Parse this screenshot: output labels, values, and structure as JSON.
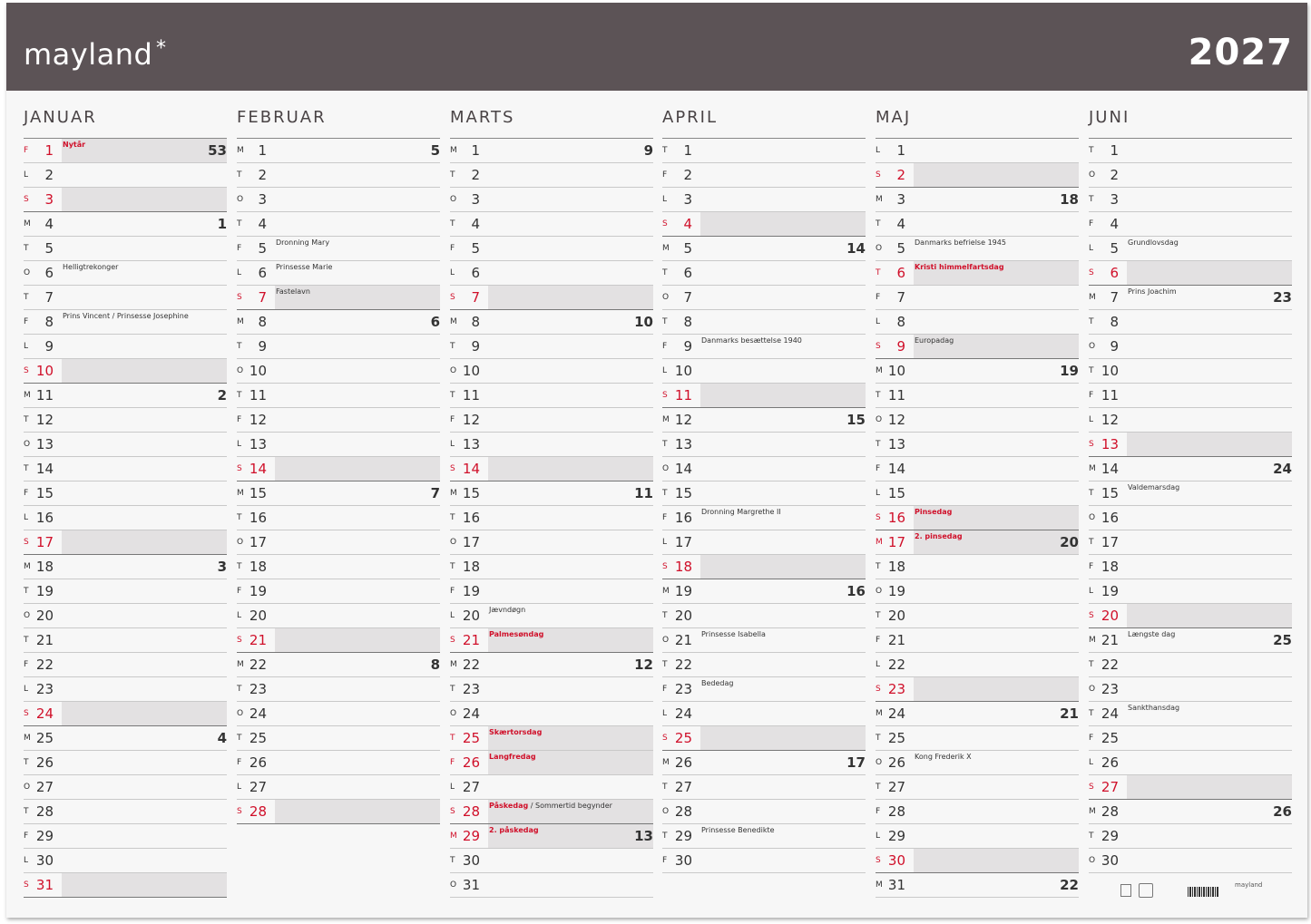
{
  "header": {
    "brand": "mayland",
    "year": "2027"
  },
  "months": [
    {
      "name": "JANUAR",
      "days": [
        {
          "d": "1",
          "w": "F",
          "red": true,
          "note": "Nytår",
          "red_note": true,
          "week": "53",
          "shade": true
        },
        {
          "d": "2",
          "w": "L"
        },
        {
          "d": "3",
          "w": "S",
          "red": true,
          "sun": true
        },
        {
          "d": "4",
          "w": "M",
          "week": "1"
        },
        {
          "d": "5",
          "w": "T"
        },
        {
          "d": "6",
          "w": "O",
          "note": "Helligtrekonger"
        },
        {
          "d": "7",
          "w": "T"
        },
        {
          "d": "8",
          "w": "F",
          "note": "Prins Vincent / Prinsesse Josephine"
        },
        {
          "d": "9",
          "w": "L"
        },
        {
          "d": "10",
          "w": "S",
          "red": true,
          "sun": true
        },
        {
          "d": "11",
          "w": "M",
          "week": "2"
        },
        {
          "d": "12",
          "w": "T"
        },
        {
          "d": "13",
          "w": "O"
        },
        {
          "d": "14",
          "w": "T"
        },
        {
          "d": "15",
          "w": "F"
        },
        {
          "d": "16",
          "w": "L"
        },
        {
          "d": "17",
          "w": "S",
          "red": true,
          "sun": true
        },
        {
          "d": "18",
          "w": "M",
          "week": "3"
        },
        {
          "d": "19",
          "w": "T"
        },
        {
          "d": "20",
          "w": "O"
        },
        {
          "d": "21",
          "w": "T"
        },
        {
          "d": "22",
          "w": "F"
        },
        {
          "d": "23",
          "w": "L"
        },
        {
          "d": "24",
          "w": "S",
          "red": true,
          "sun": true
        },
        {
          "d": "25",
          "w": "M",
          "week": "4"
        },
        {
          "d": "26",
          "w": "T"
        },
        {
          "d": "27",
          "w": "O"
        },
        {
          "d": "28",
          "w": "T"
        },
        {
          "d": "29",
          "w": "F"
        },
        {
          "d": "30",
          "w": "L"
        },
        {
          "d": "31",
          "w": "S",
          "red": true,
          "sun": true
        }
      ]
    },
    {
      "name": "FEBRUAR",
      "days": [
        {
          "d": "1",
          "w": "M",
          "week": "5"
        },
        {
          "d": "2",
          "w": "T"
        },
        {
          "d": "3",
          "w": "O"
        },
        {
          "d": "4",
          "w": "T"
        },
        {
          "d": "5",
          "w": "F",
          "note": "Dronning Mary"
        },
        {
          "d": "6",
          "w": "L",
          "note": "Prinsesse Marie"
        },
        {
          "d": "7",
          "w": "S",
          "red": true,
          "sun": true,
          "note": "Fastelavn"
        },
        {
          "d": "8",
          "w": "M",
          "week": "6"
        },
        {
          "d": "9",
          "w": "T"
        },
        {
          "d": "10",
          "w": "O"
        },
        {
          "d": "11",
          "w": "T"
        },
        {
          "d": "12",
          "w": "F"
        },
        {
          "d": "13",
          "w": "L"
        },
        {
          "d": "14",
          "w": "S",
          "red": true,
          "sun": true
        },
        {
          "d": "15",
          "w": "M",
          "week": "7"
        },
        {
          "d": "16",
          "w": "T"
        },
        {
          "d": "17",
          "w": "O"
        },
        {
          "d": "18",
          "w": "T"
        },
        {
          "d": "19",
          "w": "F"
        },
        {
          "d": "20",
          "w": "L"
        },
        {
          "d": "21",
          "w": "S",
          "red": true,
          "sun": true
        },
        {
          "d": "22",
          "w": "M",
          "week": "8"
        },
        {
          "d": "23",
          "w": "T"
        },
        {
          "d": "24",
          "w": "O"
        },
        {
          "d": "25",
          "w": "T"
        },
        {
          "d": "26",
          "w": "F"
        },
        {
          "d": "27",
          "w": "L"
        },
        {
          "d": "28",
          "w": "S",
          "red": true,
          "sun": true
        }
      ]
    },
    {
      "name": "MARTS",
      "days": [
        {
          "d": "1",
          "w": "M",
          "week": "9"
        },
        {
          "d": "2",
          "w": "T"
        },
        {
          "d": "3",
          "w": "O"
        },
        {
          "d": "4",
          "w": "T"
        },
        {
          "d": "5",
          "w": "F"
        },
        {
          "d": "6",
          "w": "L"
        },
        {
          "d": "7",
          "w": "S",
          "red": true,
          "sun": true
        },
        {
          "d": "8",
          "w": "M",
          "week": "10"
        },
        {
          "d": "9",
          "w": "T"
        },
        {
          "d": "10",
          "w": "O"
        },
        {
          "d": "11",
          "w": "T"
        },
        {
          "d": "12",
          "w": "F"
        },
        {
          "d": "13",
          "w": "L"
        },
        {
          "d": "14",
          "w": "S",
          "red": true,
          "sun": true
        },
        {
          "d": "15",
          "w": "M",
          "week": "11"
        },
        {
          "d": "16",
          "w": "T"
        },
        {
          "d": "17",
          "w": "O"
        },
        {
          "d": "18",
          "w": "T"
        },
        {
          "d": "19",
          "w": "F"
        },
        {
          "d": "20",
          "w": "L",
          "note": "Jævndøgn"
        },
        {
          "d": "21",
          "w": "S",
          "red": true,
          "sun": true,
          "note": "Palmesøndag",
          "red_note": true
        },
        {
          "d": "22",
          "w": "M",
          "week": "12"
        },
        {
          "d": "23",
          "w": "T"
        },
        {
          "d": "24",
          "w": "O"
        },
        {
          "d": "25",
          "w": "T",
          "red": true,
          "hol": true,
          "note": "Skærtorsdag",
          "red_note": true
        },
        {
          "d": "26",
          "w": "F",
          "red": true,
          "hol": true,
          "note": "Langfredag",
          "red_note": true
        },
        {
          "d": "27",
          "w": "L"
        },
        {
          "d": "28",
          "w": "S",
          "red": true,
          "sun": true,
          "note": "Påskedag",
          "red_note": true,
          "note_extra": " / Sommertid begynder"
        },
        {
          "d": "29",
          "w": "M",
          "red": true,
          "hol": true,
          "note": "2. påskedag",
          "red_note": true,
          "week": "13"
        },
        {
          "d": "30",
          "w": "T"
        },
        {
          "d": "31",
          "w": "O"
        }
      ]
    },
    {
      "name": "APRIL",
      "days": [
        {
          "d": "1",
          "w": "T"
        },
        {
          "d": "2",
          "w": "F"
        },
        {
          "d": "3",
          "w": "L"
        },
        {
          "d": "4",
          "w": "S",
          "red": true,
          "sun": true
        },
        {
          "d": "5",
          "w": "M",
          "week": "14"
        },
        {
          "d": "6",
          "w": "T"
        },
        {
          "d": "7",
          "w": "O"
        },
        {
          "d": "8",
          "w": "T"
        },
        {
          "d": "9",
          "w": "F",
          "note": "Danmarks besættelse 1940"
        },
        {
          "d": "10",
          "w": "L"
        },
        {
          "d": "11",
          "w": "S",
          "red": true,
          "sun": true
        },
        {
          "d": "12",
          "w": "M",
          "week": "15"
        },
        {
          "d": "13",
          "w": "T"
        },
        {
          "d": "14",
          "w": "O"
        },
        {
          "d": "15",
          "w": "T"
        },
        {
          "d": "16",
          "w": "F",
          "note": "Dronning Margrethe II"
        },
        {
          "d": "17",
          "w": "L"
        },
        {
          "d": "18",
          "w": "S",
          "red": true,
          "sun": true
        },
        {
          "d": "19",
          "w": "M",
          "week": "16"
        },
        {
          "d": "20",
          "w": "T"
        },
        {
          "d": "21",
          "w": "O",
          "note": "Prinsesse Isabella"
        },
        {
          "d": "22",
          "w": "T"
        },
        {
          "d": "23",
          "w": "F",
          "note": "Bededag"
        },
        {
          "d": "24",
          "w": "L"
        },
        {
          "d": "25",
          "w": "S",
          "red": true,
          "sun": true
        },
        {
          "d": "26",
          "w": "M",
          "week": "17"
        },
        {
          "d": "27",
          "w": "T"
        },
        {
          "d": "28",
          "w": "O"
        },
        {
          "d": "29",
          "w": "T",
          "note": "Prinsesse Benedikte"
        },
        {
          "d": "30",
          "w": "F"
        }
      ]
    },
    {
      "name": "MAJ",
      "days": [
        {
          "d": "1",
          "w": "L"
        },
        {
          "d": "2",
          "w": "S",
          "red": true,
          "sun": true
        },
        {
          "d": "3",
          "w": "M",
          "week": "18"
        },
        {
          "d": "4",
          "w": "T"
        },
        {
          "d": "5",
          "w": "O",
          "note": "Danmarks befrielse 1945"
        },
        {
          "d": "6",
          "w": "T",
          "red": true,
          "hol": true,
          "note": "Kristi himmelfartsdag",
          "red_note": true
        },
        {
          "d": "7",
          "w": "F"
        },
        {
          "d": "8",
          "w": "L"
        },
        {
          "d": "9",
          "w": "S",
          "red": true,
          "sun": true,
          "note": "Europadag"
        },
        {
          "d": "10",
          "w": "M",
          "week": "19"
        },
        {
          "d": "11",
          "w": "T"
        },
        {
          "d": "12",
          "w": "O"
        },
        {
          "d": "13",
          "w": "T"
        },
        {
          "d": "14",
          "w": "F"
        },
        {
          "d": "15",
          "w": "L"
        },
        {
          "d": "16",
          "w": "S",
          "red": true,
          "sun": true,
          "note": "Pinsedag",
          "red_note": true
        },
        {
          "d": "17",
          "w": "M",
          "red": true,
          "hol": true,
          "note": "2. pinsedag",
          "red_note": true,
          "week": "20"
        },
        {
          "d": "18",
          "w": "T"
        },
        {
          "d": "19",
          "w": "O"
        },
        {
          "d": "20",
          "w": "T"
        },
        {
          "d": "21",
          "w": "F"
        },
        {
          "d": "22",
          "w": "L"
        },
        {
          "d": "23",
          "w": "S",
          "red": true,
          "sun": true
        },
        {
          "d": "24",
          "w": "M",
          "week": "21"
        },
        {
          "d": "25",
          "w": "T"
        },
        {
          "d": "26",
          "w": "O",
          "note": "Kong Frederik X"
        },
        {
          "d": "27",
          "w": "T"
        },
        {
          "d": "28",
          "w": "F"
        },
        {
          "d": "29",
          "w": "L"
        },
        {
          "d": "30",
          "w": "S",
          "red": true,
          "sun": true
        },
        {
          "d": "31",
          "w": "M",
          "week": "22"
        }
      ]
    },
    {
      "name": "JUNI",
      "days": [
        {
          "d": "1",
          "w": "T"
        },
        {
          "d": "2",
          "w": "O"
        },
        {
          "d": "3",
          "w": "T"
        },
        {
          "d": "4",
          "w": "F"
        },
        {
          "d": "5",
          "w": "L",
          "note": "Grundlovsdag"
        },
        {
          "d": "6",
          "w": "S",
          "red": true,
          "sun": true
        },
        {
          "d": "7",
          "w": "M",
          "note": "Prins Joachim",
          "week": "23"
        },
        {
          "d": "8",
          "w": "T"
        },
        {
          "d": "9",
          "w": "O"
        },
        {
          "d": "10",
          "w": "T"
        },
        {
          "d": "11",
          "w": "F"
        },
        {
          "d": "12",
          "w": "L"
        },
        {
          "d": "13",
          "w": "S",
          "red": true,
          "sun": true
        },
        {
          "d": "14",
          "w": "M",
          "week": "24"
        },
        {
          "d": "15",
          "w": "T",
          "note": "Valdemarsdag"
        },
        {
          "d": "16",
          "w": "O"
        },
        {
          "d": "17",
          "w": "T"
        },
        {
          "d": "18",
          "w": "F"
        },
        {
          "d": "19",
          "w": "L"
        },
        {
          "d": "20",
          "w": "S",
          "red": true,
          "sun": true
        },
        {
          "d": "21",
          "w": "M",
          "note": "Længste dag",
          "week": "25"
        },
        {
          "d": "22",
          "w": "T"
        },
        {
          "d": "23",
          "w": "O"
        },
        {
          "d": "24",
          "w": "T",
          "note": "Sankthansdag"
        },
        {
          "d": "25",
          "w": "F"
        },
        {
          "d": "26",
          "w": "L"
        },
        {
          "d": "27",
          "w": "S",
          "red": true,
          "sun": true
        },
        {
          "d": "28",
          "w": "M",
          "week": "26"
        },
        {
          "d": "29",
          "w": "T"
        },
        {
          "d": "30",
          "w": "O"
        }
      ]
    }
  ],
  "footer": {
    "mini_brand": "mayland"
  }
}
